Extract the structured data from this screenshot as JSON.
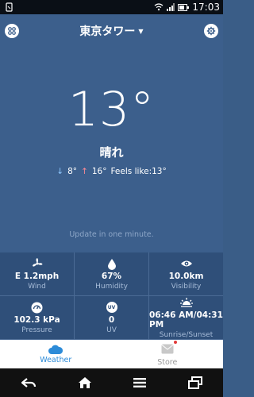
{
  "status": {
    "time": "17:03"
  },
  "header": {
    "city": "東京タワー"
  },
  "current": {
    "temperature": "13°",
    "condition": "晴れ",
    "low": "8°",
    "high": "16°",
    "feels_like": "Feels like:13°"
  },
  "update_text": "Update in one minute.",
  "details": [
    {
      "icon": "wind-icon",
      "value": "E 1.2mph",
      "label": "Wind"
    },
    {
      "icon": "humidity-icon",
      "value": "67%",
      "label": "Humidity"
    },
    {
      "icon": "visibility-icon",
      "value": "10.0km",
      "label": "Visibility"
    },
    {
      "icon": "pressure-icon",
      "value": "102.3 kPa",
      "label": "Pressure"
    },
    {
      "icon": "uv-icon",
      "value": "0",
      "label": "UV",
      "badge": "UV"
    },
    {
      "icon": "sunrise-icon",
      "value": "06:46 AM/04:31 PM",
      "label": "Sunrise/Sunset"
    }
  ],
  "tabs": [
    {
      "label": "Weather",
      "active": true
    },
    {
      "label": "Store",
      "active": false
    }
  ],
  "colors": {
    "background": "#3c5f8c",
    "accent": "#2c8bd8",
    "high": "#ff8a95",
    "low": "#8fc8ff"
  }
}
